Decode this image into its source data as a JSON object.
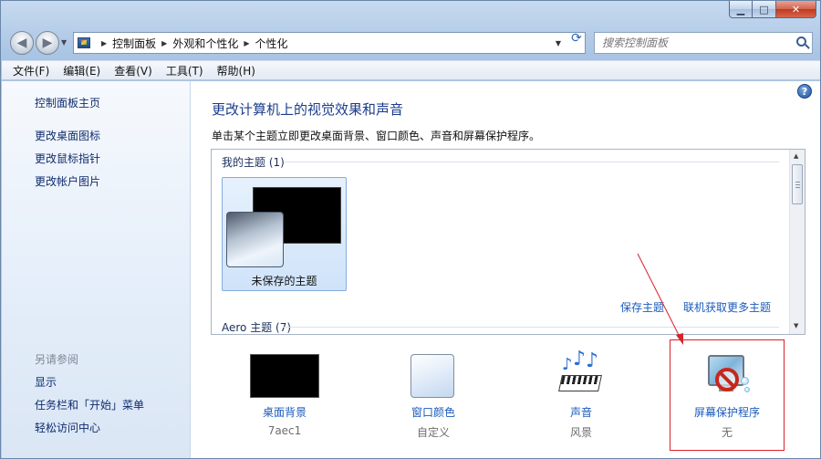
{
  "window": {
    "minimize_glyph": "▁",
    "maximize_glyph": "□",
    "close_glyph": "✕"
  },
  "nav": {
    "back_glyph": "◀",
    "forward_glyph": "▶",
    "breadcrumbs": [
      "控制面板",
      "外观和个性化",
      "个性化"
    ],
    "refresh_glyph": "⟳",
    "search_placeholder": "搜索控制面板"
  },
  "menu": [
    "文件(F)",
    "编辑(E)",
    "查看(V)",
    "工具(T)",
    "帮助(H)"
  ],
  "sidebar": {
    "links": [
      "控制面板主页",
      "更改桌面图标",
      "更改鼠标指针",
      "更改帐户图片"
    ],
    "see_also_heading": "另请参阅",
    "see_also_links": [
      "显示",
      "任务栏和「开始」菜单",
      "轻松访问中心"
    ]
  },
  "main": {
    "help_glyph": "?",
    "title": "更改计算机上的视觉效果和声音",
    "description": "单击某个主题立即更改桌面背景、窗口颜色、声音和屏幕保护程序。",
    "my_themes_label": "我的主题 (1)",
    "theme_name": "未保存的主题",
    "save_theme_link": "保存主题",
    "get_more_link": "联机获取更多主题",
    "aero_label": "Aero 主题 (7)"
  },
  "settings": [
    {
      "label": "桌面背景",
      "value": "7aec1",
      "icon": "desktop-background-icon"
    },
    {
      "label": "窗口颜色",
      "value": "自定义",
      "icon": "window-color-icon"
    },
    {
      "label": "声音",
      "value": "风景",
      "icon": "sounds-icon"
    },
    {
      "label": "屏幕保护程序",
      "value": "无",
      "icon": "screen-saver-icon"
    }
  ],
  "colors": {
    "link": "#1b5bbd",
    "title": "#1c3d8d",
    "highlight": "#d8232a"
  }
}
